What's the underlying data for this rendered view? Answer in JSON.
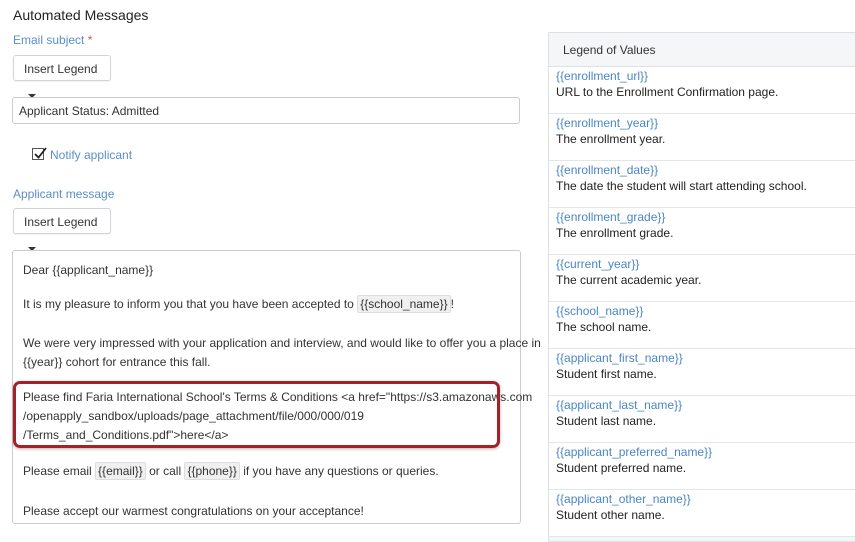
{
  "section_title": "Automated Messages",
  "email_subject": {
    "label": "Email subject",
    "required_marker": "*",
    "insert_legend_label": "Insert Legend",
    "value": "Applicant Status: Admitted"
  },
  "notify": {
    "label": "Notify applicant",
    "checked": true
  },
  "applicant_message": {
    "label": "Applicant message",
    "insert_legend_label": "Insert Legend",
    "lines": {
      "greeting": "Dear {{applicant_name}}",
      "p1_pre": "It is my pleasure to inform you that you have been accepted to",
      "p1_tag": "{{school_name}}",
      "p1_post": "!",
      "p2_line1": "We were very impressed with your application and interview, and would like to offer you a place in",
      "p2_line2": "{{year}} cohort for entrance this fall.",
      "p3_line1": "Please find Faria International School's Terms & Conditions <a href=\"https://s3.amazonaws.com",
      "p3_line2": "/openapply_sandbox/uploads/page_attachment/file/000/000/019",
      "p3_line3": "/Terms_and_Conditions.pdf\">here</a>",
      "p4_pre": "Please email",
      "p4_tag1": "{{email}}",
      "p4_mid": "or call",
      "p4_tag2": "{{phone}}",
      "p4_post": "if you have any questions or queries.",
      "p5": "Please accept our warmest congratulations on your acceptance!"
    }
  },
  "legend": {
    "title": "Legend of Values",
    "items": [
      {
        "var": "{{enrollment_url}}",
        "desc": "URL to the Enrollment Confirmation page."
      },
      {
        "var": "{{enrollment_year}}",
        "desc": "The enrollment year."
      },
      {
        "var": "{{enrollment_date}}",
        "desc": "The date the student will start attending school."
      },
      {
        "var": "{{enrollment_grade}}",
        "desc": "The enrollment grade."
      },
      {
        "var": "{{current_year}}",
        "desc": "The current academic year."
      },
      {
        "var": "{{school_name}}",
        "desc": "The school name."
      },
      {
        "var": "{{applicant_first_name}}",
        "desc": "Student first name."
      },
      {
        "var": "{{applicant_last_name}}",
        "desc": "Student last name."
      },
      {
        "var": "{{applicant_preferred_name}}",
        "desc": "Student preferred name."
      },
      {
        "var": "{{applicant_other_name}}",
        "desc": "Student other name."
      }
    ]
  }
}
